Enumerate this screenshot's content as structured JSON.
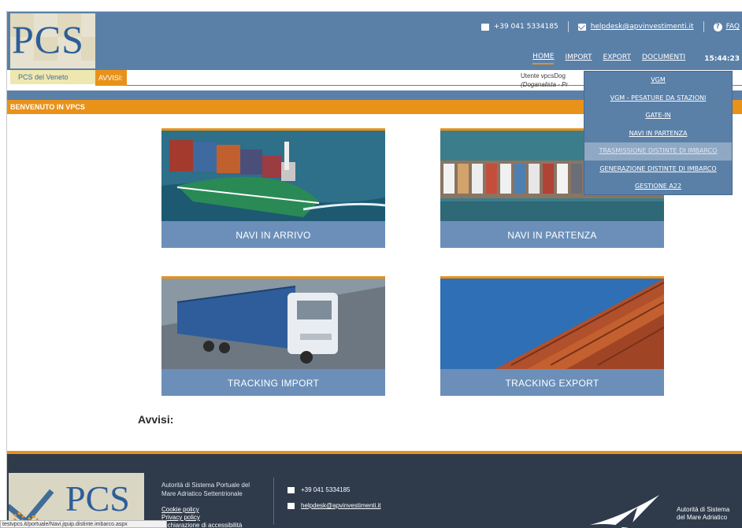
{
  "header": {
    "logo": "PCS",
    "phone": "+39 041 5334185",
    "email": "helpdesk@apvinvestimenti.it",
    "faq": "FAQ",
    "nav": [
      "HOME",
      "IMPORT",
      "EXPORT",
      "DOCUMENTI"
    ],
    "clock": "15:44:23"
  },
  "subheader": {
    "pcs_veneto": "PCS del Veneto",
    "avvisi_label": "AVVISI:",
    "user_line1": "Utente vpcsDog",
    "user_line2": "(Doganalista - Pr"
  },
  "page_title": "BENVENUTO IN VPCS",
  "export_menu": [
    "VGM",
    "VGM - PESATURE DA STAZIONI",
    "GATE-IN",
    "NAVI IN PARTENZA",
    "TRASMISSIONE DISTINTE DI IMBARCO",
    "GENERAZIONE DISTINTE DI IMBARCO",
    "GESTIONE A22"
  ],
  "tiles": [
    "NAVI IN ARRIVO",
    "NAVI IN PARTENZA",
    "TRACKING IMPORT",
    "TRACKING EXPORT"
  ],
  "avvisi_title": "Avvisi:",
  "footer": {
    "logo": "PCS",
    "authority_line1": "Autorità di Sistema Portuale del",
    "authority_line2": "Mare Adriatico Settentrionale",
    "cookie": "Cookie policy",
    "privacy": "Privacy policy",
    "accessibility": "Dichiarazione di accessibilità",
    "phone": "+39 041 5334185",
    "email": "helpdesk@apvinvestimenti.it",
    "right_line1": "Autorità di Sistema",
    "right_line2": "del Mare Adriatico"
  },
  "status_url": "testvpcs.it/portuale/Navi.jquip.distinte.imbarco.aspx"
}
